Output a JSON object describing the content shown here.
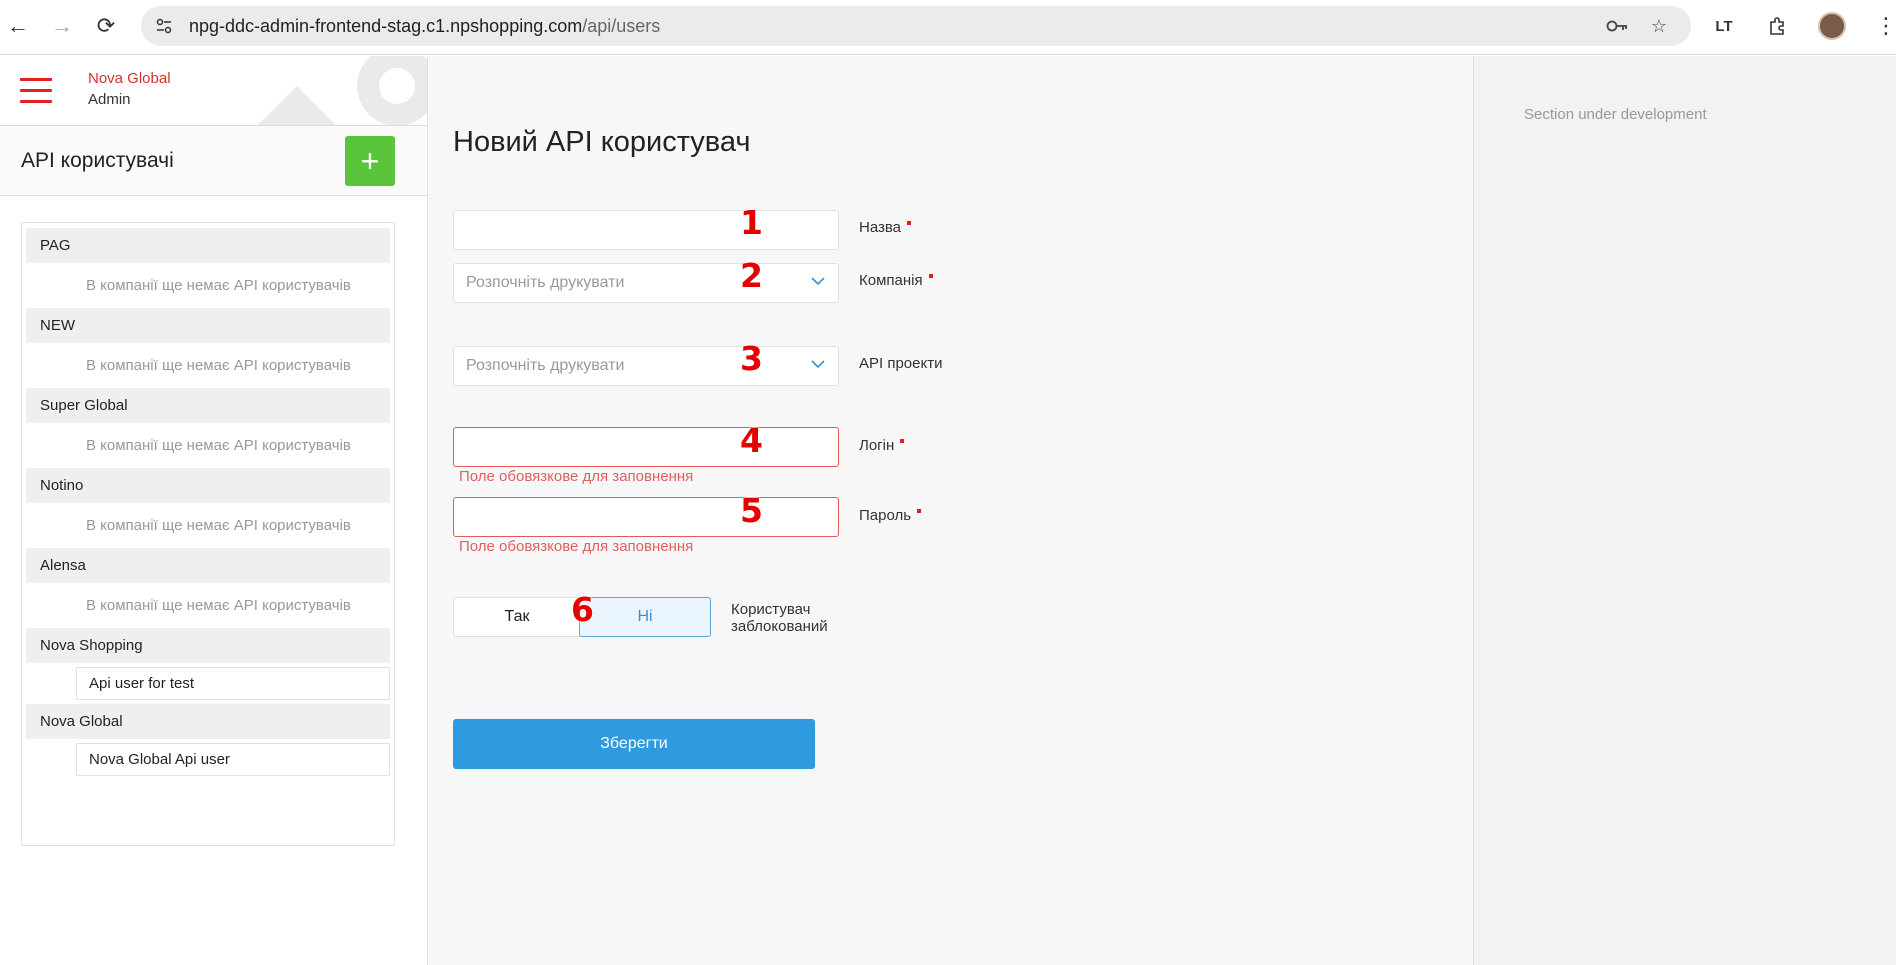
{
  "browser": {
    "back_icon": "back-arrow-icon",
    "forward_icon": "forward-arrow-icon",
    "reload_icon": "reload-icon",
    "url_domain": "npg-ddc-admin-frontend-stag.c1.npshopping.com",
    "url_path": "/api/users"
  },
  "sidebar": {
    "brand_top": "Nova Global",
    "brand_bottom": "Admin",
    "title": "API користувачі",
    "add_label": "+",
    "companies": [
      {
        "name": "PAG",
        "users": [],
        "empty": "В компанії ще немає API користувачів"
      },
      {
        "name": "NEW",
        "users": [],
        "empty": "В компанії ще немає API користувачів"
      },
      {
        "name": "Super Global",
        "users": [],
        "empty": "В компанії ще немає API користувачів"
      },
      {
        "name": "Notino",
        "users": [],
        "empty": "В компанії ще немає API користувачів"
      },
      {
        "name": "Alensa",
        "users": [],
        "empty": "В компанії ще немає API користувачів"
      },
      {
        "name": "Nova Shopping",
        "users": [
          "Api user for test"
        ],
        "empty": ""
      },
      {
        "name": "Nova Global",
        "users": [
          "Nova Global Api user"
        ],
        "empty": ""
      }
    ]
  },
  "form": {
    "title": "Новий API користувач",
    "name_label": "Назва",
    "company_label": "Компанія",
    "company_placeholder": "Розпочніть друкувати",
    "projects_label": "API проекти",
    "projects_placeholder": "Розпочніть друкувати",
    "login_label": "Логін",
    "password_label": "Пароль",
    "required_error": "Поле обовязкове для заповнення",
    "blocked_yes": "Так",
    "blocked_no": "Ні",
    "blocked_label": "Користувач заблокований",
    "save_label": "Зберегти"
  },
  "markers": [
    "1",
    "2",
    "3",
    "4",
    "5",
    "6"
  ],
  "right_panel": {
    "note": "Section under development"
  },
  "colors": {
    "brand_red": "#e02020",
    "add_green": "#5ac43c",
    "save_blue": "#2f9ae0",
    "error_red": "#e45a5a"
  }
}
